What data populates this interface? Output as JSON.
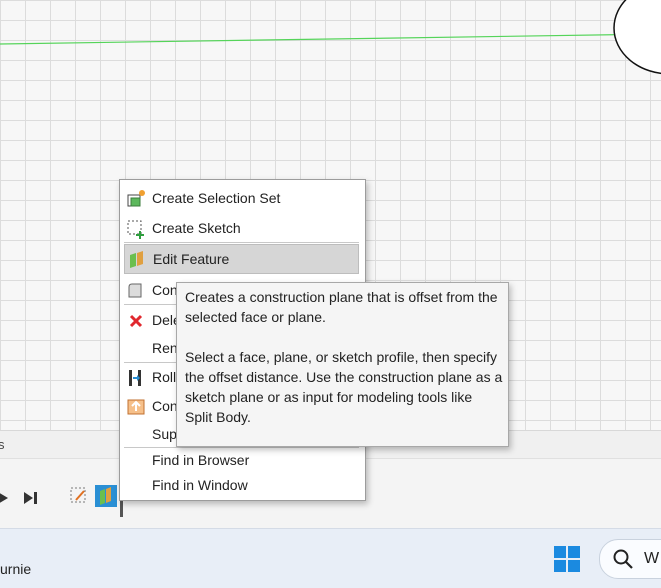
{
  "context_menu": {
    "items": [
      {
        "label": "Create Selection Set",
        "icon": "selection-set-icon"
      },
      {
        "label": "Create Sketch",
        "icon": "create-sketch-icon"
      },
      {
        "label": "Edit Feature",
        "icon": "edit-feature-icon",
        "highlighted": true
      },
      {
        "label": "Con",
        "icon": "construction-plane-icon"
      },
      {
        "label": "Dele",
        "icon": "delete-icon"
      },
      {
        "label": "Ren",
        "icon": ""
      },
      {
        "label": "Roll",
        "icon": "roll-icon"
      },
      {
        "label": "Con",
        "icon": "compute-icon"
      },
      {
        "label": "Sup",
        "icon": ""
      },
      {
        "label": "Find in Browser",
        "icon": ""
      },
      {
        "label": "Find in Window",
        "icon": ""
      }
    ]
  },
  "tooltip": {
    "paragraph1": "Creates a construction plane that is offset from the selected face or plane.",
    "paragraph2": "Select a face, plane, or sketch profile, then specify the offset distance. Use the construction plane as a sketch plane or as input for modeling tools like Split Body."
  },
  "panel": {
    "edge_label": "s"
  },
  "taskbar": {
    "partial_text": "urnie",
    "search_text": "W"
  },
  "colors": {
    "axis_green": "#55d45a",
    "highlight": "#d6d6d6",
    "timeline_active": "#2a8fd4",
    "delete_red": "#e0282e"
  }
}
